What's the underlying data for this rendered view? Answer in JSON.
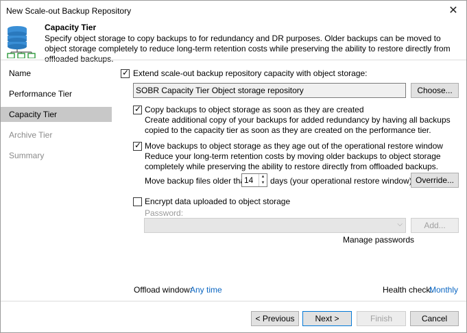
{
  "window": {
    "title": "New Scale-out Backup Repository",
    "close_glyph": "✕"
  },
  "header": {
    "title": "Capacity Tier",
    "description": "Specify object storage to copy backups to for redundancy and DR purposes. Older backups can be moved to object storage completely to reduce long-term retention costs while preserving the ability to restore directly from offloaded backups.",
    "icon": "repository-storage-icon"
  },
  "nav": {
    "items": [
      {
        "label": "Name"
      },
      {
        "label": "Performance Tier"
      },
      {
        "label": "Capacity Tier"
      },
      {
        "label": "Archive Tier"
      },
      {
        "label": "Summary"
      }
    ]
  },
  "capacity": {
    "extend_label": "Extend scale-out backup repository capacity with object storage:",
    "extend_checked": true,
    "repository_value": "SOBR Capacity Tier Object storage repository",
    "choose_label": "Choose...",
    "copy_label": "Copy backups to object storage as soon as they are created",
    "copy_checked": true,
    "copy_desc": "Create additional copy of your backups for added redundancy by having all backups copied to the capacity tier as soon as they are created on the performance tier.",
    "move_label": "Move backups to object storage as they age out of the operational restore window",
    "move_checked": true,
    "move_desc": "Reduce your long-term retention costs by moving older backups to object storage completely while preserving the ability to restore directly from offloaded backups.",
    "move_older_prefix": "Move backup files older than",
    "move_older_days": "14",
    "move_older_suffix": "days (your operational restore window)",
    "override_label": "Override...",
    "encrypt_label": "Encrypt data uploaded to object storage",
    "encrypt_checked": false,
    "password_label": "Password:",
    "password_value": "",
    "add_label": "Add...",
    "manage_passwords_label": "Manage passwords",
    "offload_label": "Offload window:",
    "offload_value": "Any time",
    "health_label": "Health check:",
    "health_value": "Monthly"
  },
  "footer": {
    "previous_label": "< Previous",
    "next_label": "Next >",
    "finish_label": "Finish",
    "cancel_label": "Cancel"
  },
  "colors": {
    "accent": "#0078d7",
    "link": "#0a66c2",
    "nav_active": "#c8c8c8"
  }
}
